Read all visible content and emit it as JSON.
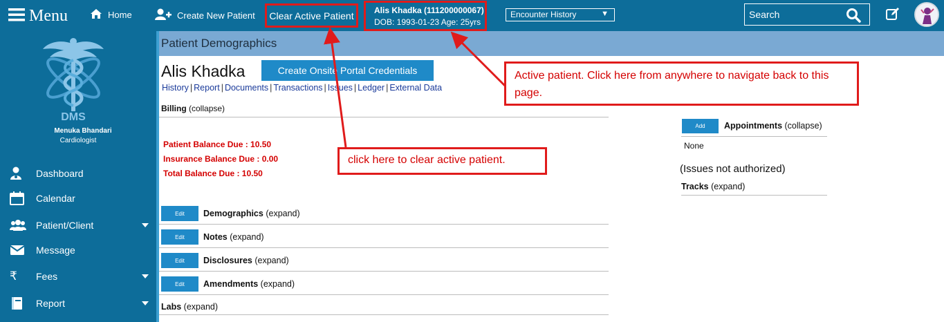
{
  "topbar": {
    "menu_label": "Menu",
    "home_label": "Home",
    "create_patient_label": "Create New Patient",
    "clear_active_label": "Clear Active Patient",
    "active_patient": {
      "name_line": "Alis Khadka (111200000067)",
      "dob_line": "DOB: 1993-01-23 Age: 25yrs"
    },
    "encounter_select": "Encounter History",
    "search_placeholder": "Search"
  },
  "sidebar": {
    "logo_text": "DMS",
    "doctor_name": "Menuka Bhandari",
    "doctor_role": "Cardiologist",
    "items": [
      {
        "label": "Dashboard",
        "icon": "doctor-icon"
      },
      {
        "label": "Calendar",
        "icon": "calendar-icon"
      },
      {
        "label": "Patient/Client",
        "icon": "users-icon",
        "has_submenu": true
      },
      {
        "label": "Message",
        "icon": "envelope-icon"
      },
      {
        "label": "Fees",
        "icon": "rupee-icon",
        "has_submenu": true
      },
      {
        "label": "Report",
        "icon": "book-icon",
        "has_submenu": true
      }
    ]
  },
  "main": {
    "title": "Patient Demographics",
    "patient_name": "Alis Khadka",
    "portal_button": "Create Onsite Portal Credentials",
    "tabs": [
      "History",
      "Report",
      "Documents",
      "Transactions",
      "Issues",
      "Ledger",
      "External Data"
    ],
    "billing": {
      "title": "Billing",
      "toggle": "(collapse)",
      "patient_balance": "Patient Balance Due : 10.50",
      "insurance_balance": "Insurance Balance Due : 0.00",
      "total_balance": "Total Balance Due : 10.50"
    },
    "edit_label": "Edit",
    "sections": [
      {
        "title": "Demographics",
        "toggle": "(expand)"
      },
      {
        "title": "Notes",
        "toggle": "(expand)"
      },
      {
        "title": "Disclosures",
        "toggle": "(expand)"
      },
      {
        "title": "Amendments",
        "toggle": "(expand)"
      }
    ],
    "labs": {
      "title": "Labs",
      "toggle": "(expand)"
    }
  },
  "right": {
    "add_label": "Add",
    "appointments_title": "Appointments",
    "appointments_toggle": "(collapse)",
    "appointments_value": "None",
    "issues_text": "(Issues not authorized)",
    "tracks_title": "Tracks",
    "tracks_toggle": "(expand)"
  },
  "annotations": {
    "active_patient_note": "Active patient. Click here from anywhere to navigate back to this page.",
    "clear_note": "click here to clear active patient."
  },
  "colors": {
    "brand": "#0d6d9a",
    "button": "#1f8ac8",
    "title_bar": "#7aa9d3",
    "annotation": "#e01b1b",
    "balance_text": "#d40000"
  }
}
